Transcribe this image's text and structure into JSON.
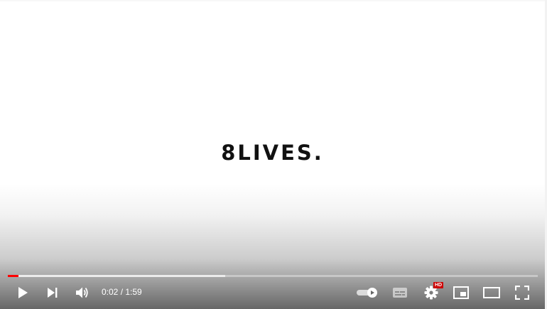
{
  "video": {
    "logo_text": "8LIVES."
  },
  "progress": {
    "played_fraction": 0.02,
    "loaded_fraction": 0.41
  },
  "time": {
    "current": "0:02",
    "separator": " / ",
    "duration": "1:59"
  },
  "settings": {
    "quality_badge": "HD"
  },
  "icons": {
    "play": "play-icon",
    "next": "next-icon",
    "volume": "volume-icon",
    "autoplay": "autoplay-toggle-icon",
    "subtitles": "subtitles-icon",
    "settings": "gear-icon",
    "miniplayer": "miniplayer-icon",
    "theater": "theater-mode-icon",
    "fullscreen": "fullscreen-icon"
  },
  "colors": {
    "progress_played": "#ff0000",
    "hd_badge": "#cc0000",
    "controls_foreground": "#ffffff"
  }
}
